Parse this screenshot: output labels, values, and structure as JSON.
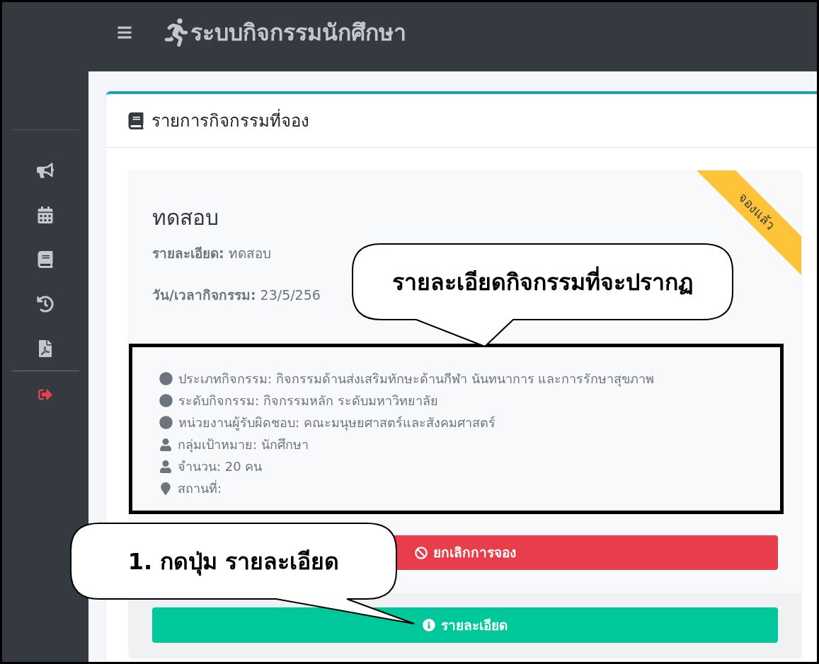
{
  "header": {
    "title": "ระบบกิจกรรมนักศึกษา"
  },
  "sidebar": {
    "items": [
      {
        "kind": "news"
      },
      {
        "kind": "calendar"
      },
      {
        "kind": "book"
      },
      {
        "kind": "history"
      },
      {
        "kind": "pdf"
      },
      {
        "kind": "logout"
      }
    ]
  },
  "panel": {
    "title": "รายการกิจกรรมที่จอง"
  },
  "activity": {
    "title": "ทดสอบ",
    "ribbon": "จองแล้ว",
    "fields": [
      {
        "label": "รายละเอียด:",
        "value": "ทดสอบ"
      },
      {
        "label": "วัน/เวลากิจกรรม:",
        "value": "23/5/256"
      }
    ],
    "details": [
      {
        "kind": "dot",
        "text": "ประเภทกิจกรรม: กิจกรรมด้านส่งเสริมทักษะด้านกีฬา นันทนาการ และการรักษาสุขภาพ"
      },
      {
        "kind": "dot",
        "text": "ระดับกิจกรรม: กิจกรรมหลัก ระดับมหาวิทยาลัย"
      },
      {
        "kind": "dot",
        "text": "หน่วยงานผู้รับผิดชอบ: คณะมนุษยศาสตร์และสังคมศาสตร์"
      },
      {
        "kind": "person",
        "text": "กลุ่มเป้าหมาย: นักศึกษา"
      },
      {
        "kind": "person",
        "text": "จำนวน: 20 คน"
      },
      {
        "kind": "place",
        "text": "สถานที่:"
      }
    ],
    "buttons": [
      {
        "kind": "cancel",
        "label": "ยกเลิกการจอง"
      },
      {
        "kind": "details",
        "label": "รายละเอียด"
      }
    ]
  },
  "callouts": [
    {
      "text": "รายละเอียดกิจกรรมที่จะปรากฏ"
    },
    {
      "text": "1. กดปุ่ม รายละเอียด"
    }
  ]
}
